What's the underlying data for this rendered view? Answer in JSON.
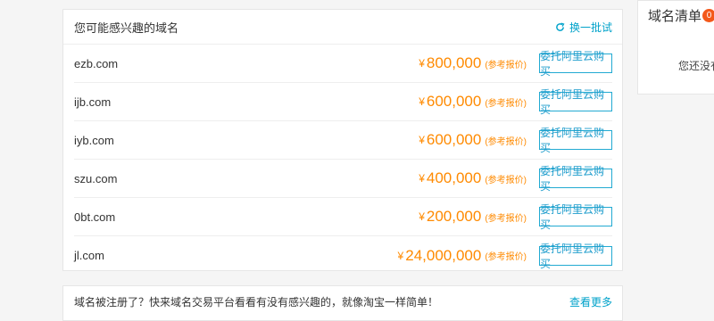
{
  "panel": {
    "title": "您可能感兴趣的域名",
    "refresh_label": "换一批试",
    "domains": [
      {
        "name": "ezb.com",
        "currency": "¥",
        "price": "800,000",
        "note": "(参考报价)",
        "buy_label": "委托阿里云购买"
      },
      {
        "name": "ijb.com",
        "currency": "¥",
        "price": "600,000",
        "note": "(参考报价)",
        "buy_label": "委托阿里云购买"
      },
      {
        "name": "iyb.com",
        "currency": "¥",
        "price": "600,000",
        "note": "(参考报价)",
        "buy_label": "委托阿里云购买"
      },
      {
        "name": "szu.com",
        "currency": "¥",
        "price": "400,000",
        "note": "(参考报价)",
        "buy_label": "委托阿里云购买"
      },
      {
        "name": "0bt.com",
        "currency": "¥",
        "price": "200,000",
        "note": "(参考报价)",
        "buy_label": "委托阿里云购买"
      },
      {
        "name": "jl.com",
        "currency": "¥",
        "price": "24,000,000",
        "note": "(参考报价)",
        "buy_label": "委托阿里云购买"
      }
    ]
  },
  "notice": {
    "text": "域名被注册了？快来域名交易平台看看有没有感兴趣的，就像淘宝一样简单！",
    "more_label": "查看更多"
  },
  "sidebar": {
    "title": "域名清单",
    "count": "0",
    "empty_text": "您还没有"
  },
  "colors": {
    "price": "#ff8a00",
    "accent": "#00a2ca",
    "badge": "#f3581a"
  },
  "icons": {
    "refresh": "refresh-icon"
  }
}
